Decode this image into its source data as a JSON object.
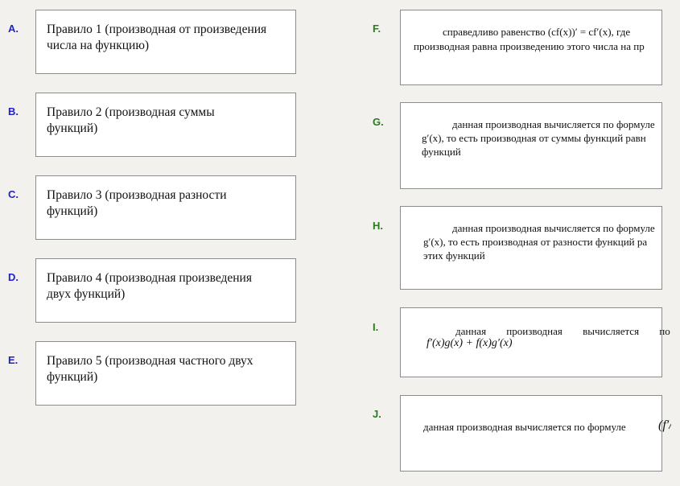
{
  "left_items": [
    {
      "letter": "A.",
      "line1": "Правило 1 (производная от произведения",
      "line2": "числа на функцию)"
    },
    {
      "letter": "B.",
      "line1": "Правило 2 (производная суммы",
      "line2": "функций)"
    },
    {
      "letter": "C.",
      "line1": "Правило 3 (производная разности",
      "line2": "функций)"
    },
    {
      "letter": "D.",
      "line1": "Правило 4 (производная произведения",
      "line2": "двух функций)"
    },
    {
      "letter": "E.",
      "line1": "Правило 5 (производная частного двух",
      "line2": "функций)"
    }
  ],
  "right_items": [
    {
      "letter": "F.",
      "line1": "справедливо равенство (cf(x))′ = cf′(x), где",
      "line2": "производная равна произведению этого числа на пр"
    },
    {
      "letter": "G.",
      "line1": "данная производная вычисляется по формуле",
      "line2": "g′(x), то есть производная от суммы функций равн",
      "line3": "функций"
    },
    {
      "letter": "H.",
      "line1": "данная производная вычисляется по формуле",
      "line2": "g′(x), то есть производная от разности функций ра",
      "line3": "этих функций"
    },
    {
      "letter": "I.",
      "line1": "данная производная вычисляется по",
      "line2": "f′(x)g(x) + f(x)g′(x)"
    },
    {
      "letter": "J.",
      "line1": "данная производная вычисляется по формуле",
      "line2": "(f′/g′)"
    }
  ]
}
